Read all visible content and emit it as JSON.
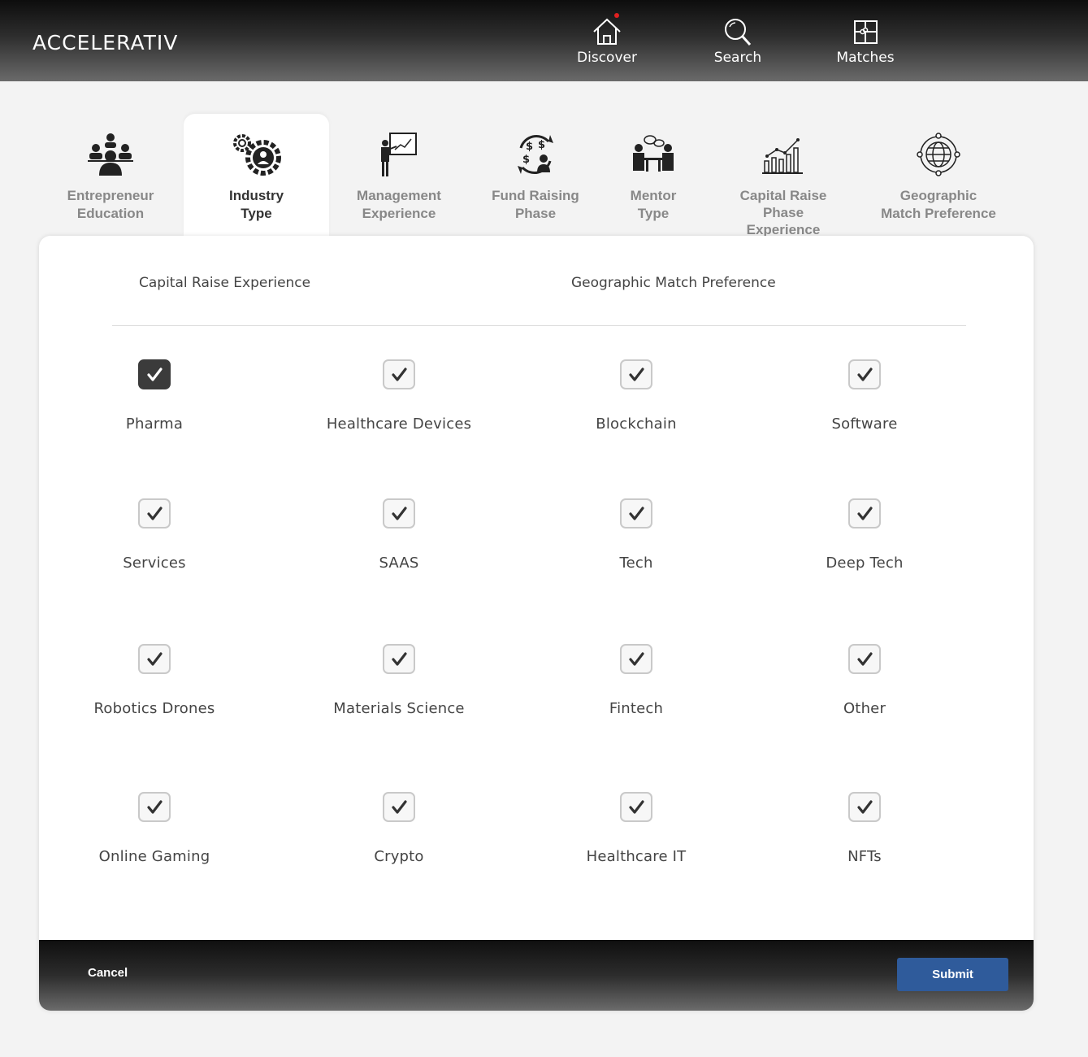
{
  "header": {
    "logo": "ACCELERATIV",
    "nav": [
      {
        "label": "Discover",
        "icon": "home-icon",
        "notification": true
      },
      {
        "label": "Search",
        "icon": "search-icon"
      },
      {
        "label": "Matches",
        "icon": "puzzle-icon"
      }
    ]
  },
  "tabs": [
    {
      "line1": "Entrepreneur",
      "line2": "Education",
      "icon": "people-icon",
      "active": false
    },
    {
      "line1": "Industry",
      "line2": "Type",
      "icon": "gears-icon",
      "active": true
    },
    {
      "line1": "Management",
      "line2": "Experience",
      "icon": "presenter-icon",
      "active": false
    },
    {
      "line1": "Fund Raising",
      "line2": "Phase",
      "icon": "money-cycle-icon",
      "active": false
    },
    {
      "line1": "Mentor",
      "line2": "Type",
      "icon": "meeting-icon",
      "active": false
    },
    {
      "line1": "Capital Raise",
      "line2": "Phase Experience",
      "icon": "growth-chart-icon",
      "active": false
    },
    {
      "line1": "Geographic",
      "line2": "Match Preference",
      "icon": "globe-icon",
      "active": false
    }
  ],
  "panel": {
    "subheads": [
      "Capital Raise Experience",
      "Geographic Match Preference"
    ],
    "options": [
      {
        "label": "Pharma",
        "checked": true
      },
      {
        "label": "Healthcare Devices",
        "checked": false
      },
      {
        "label": "Blockchain",
        "checked": false
      },
      {
        "label": "Software",
        "checked": false
      },
      {
        "label": "Services",
        "checked": false
      },
      {
        "label": "SAAS",
        "checked": false
      },
      {
        "label": "Tech",
        "checked": false
      },
      {
        "label": "Deep Tech",
        "checked": false
      },
      {
        "label": "Robotics Drones",
        "checked": false
      },
      {
        "label": "Materials Science",
        "checked": false
      },
      {
        "label": "Fintech",
        "checked": false
      },
      {
        "label": "Other",
        "checked": false
      },
      {
        "label": "Online Gaming",
        "checked": false
      },
      {
        "label": "Crypto",
        "checked": false
      },
      {
        "label": "Healthcare IT",
        "checked": false
      },
      {
        "label": "NFTs",
        "checked": false
      }
    ]
  },
  "footer": {
    "cancel_label": "Cancel",
    "submit_label": "Submit"
  },
  "colors": {
    "submit_bg": "#2f5b9b",
    "checked_bg": "#3b3b3b",
    "notification_dot": "#e02020"
  }
}
